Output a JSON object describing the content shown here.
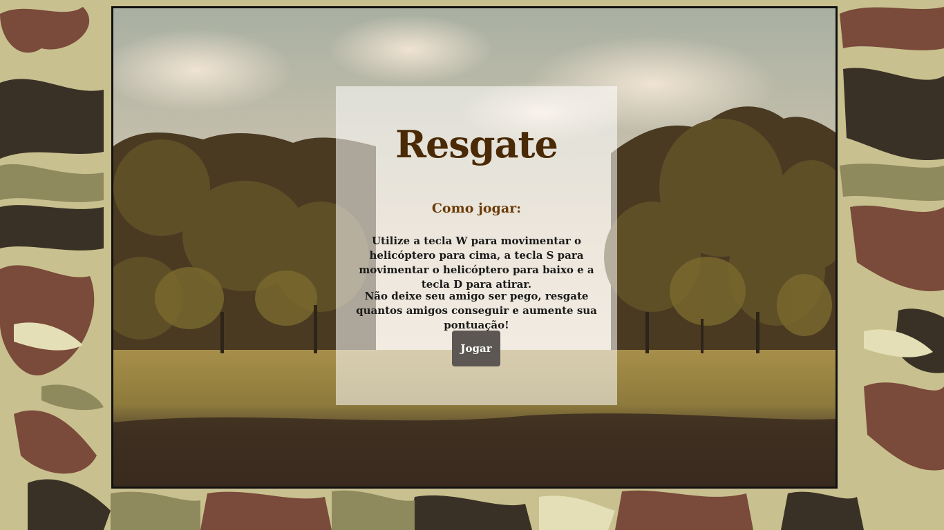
{
  "game": {
    "title": "Resgate",
    "howto_heading": "Como jogar:",
    "instructions": [
      "Utilize a tecla W para movimentar o helicóptero para cima, a tecla S para movimentar o helicóptero para baixo e a tecla D para atirar.",
      "Não deixe seu amigo ser pego, resgate quantos amigos conseguir e aumente sua pontuação!"
    ],
    "play_label": "Jogar"
  },
  "colors": {
    "title": "#4a2a06",
    "heading": "#6b3b08",
    "button": "#5c5752",
    "camo_light": "#c9c08f",
    "camo_brown": "#7a4a3a",
    "camo_dark": "#3a3126",
    "camo_olive": "#8f8a5e"
  }
}
